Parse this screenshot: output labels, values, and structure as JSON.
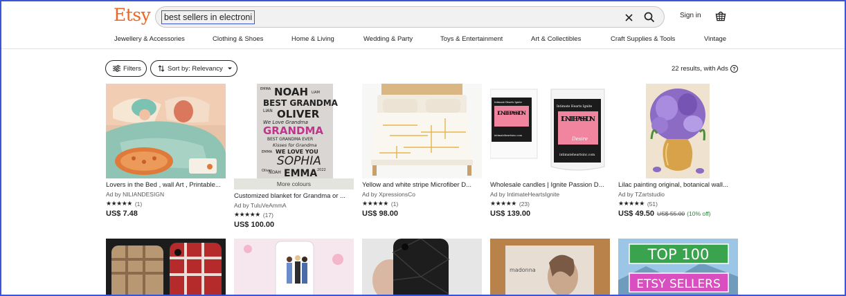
{
  "header": {
    "logo": "Etsy",
    "search": {
      "value": "best sellers in electronic",
      "placeholder": ""
    },
    "signin_label": "Sign in",
    "icons": {
      "clear": "close-icon",
      "search": "search-icon",
      "cart": "basket-icon"
    }
  },
  "nav": {
    "items": [
      {
        "label": "Jewellery & Accessories"
      },
      {
        "label": "Clothing & Shoes"
      },
      {
        "label": "Home & Living"
      },
      {
        "label": "Wedding & Party"
      },
      {
        "label": "Toys & Entertainment"
      },
      {
        "label": "Art & Collectibles"
      },
      {
        "label": "Craft Supplies & Tools"
      },
      {
        "label": "Vintage"
      }
    ]
  },
  "toolbar": {
    "filters_label": "Filters",
    "sort_label": "Sort by: Relevancy",
    "results_text": "22 results, with Ads",
    "help_glyph": "?"
  },
  "listings": [
    {
      "title": "Lovers in the Bed , wall Art , Printable...",
      "seller": "Ad by NILIANDESIGN",
      "stars": "★★★★★",
      "reviews": "(1)",
      "price": "US$ 7.48"
    },
    {
      "title": "Customized blanket for Grandma or ...",
      "seller": "Ad by TuluVeAmmA",
      "stars": "★★★★★",
      "reviews": "(17)",
      "price": "US$ 100.00",
      "badge": "More colours",
      "blanket_text": [
        "EMMA",
        "NOAH",
        "LIAM",
        "BEST GRANDMA",
        "LIAN",
        "OLIVER",
        "We Love Grandma",
        "GRANDMA",
        "BEST GRANDMA EVER",
        "Kisses for Grandma",
        "EMMA",
        "WE LOVE YOU",
        "SOPHIA",
        "Oliver",
        "NOAH",
        "EMMA",
        "2022"
      ]
    },
    {
      "title": "Yellow and white stripe Microfiber D...",
      "seller": "Ad by XpressionsCo",
      "stars": "★★★★★",
      "reviews": "(1)",
      "price": "US$ 98.00"
    },
    {
      "title": "Wholesale candles | Ignite Passion D...",
      "seller": "Ad by IntimateHeartsIgnite",
      "stars": "★★★★★",
      "reviews": "(23)",
      "price": "US$ 139.00",
      "candle_brand": "Intimate Hearts Ignite",
      "candle_name": "IGNITE PASSION",
      "candle_scent": "Desire",
      "candle_url": "intimateheartsinc.com"
    },
    {
      "title": "Lilac painting original, botanical wall...",
      "seller": "Ad by TZartstudio",
      "stars": "★★★★★",
      "reviews": "(51)",
      "price": "US$ 49.50",
      "original_price": "US$ 55.00",
      "discount": "(10% off)"
    }
  ],
  "row2": {
    "album_text": "madonna",
    "banner_top": "TOP 100",
    "banner_bottom": "ETSY SELLERS"
  },
  "colors": {
    "brand": "#f1641e",
    "focus": "#3b55d6",
    "discount": "#258635"
  }
}
